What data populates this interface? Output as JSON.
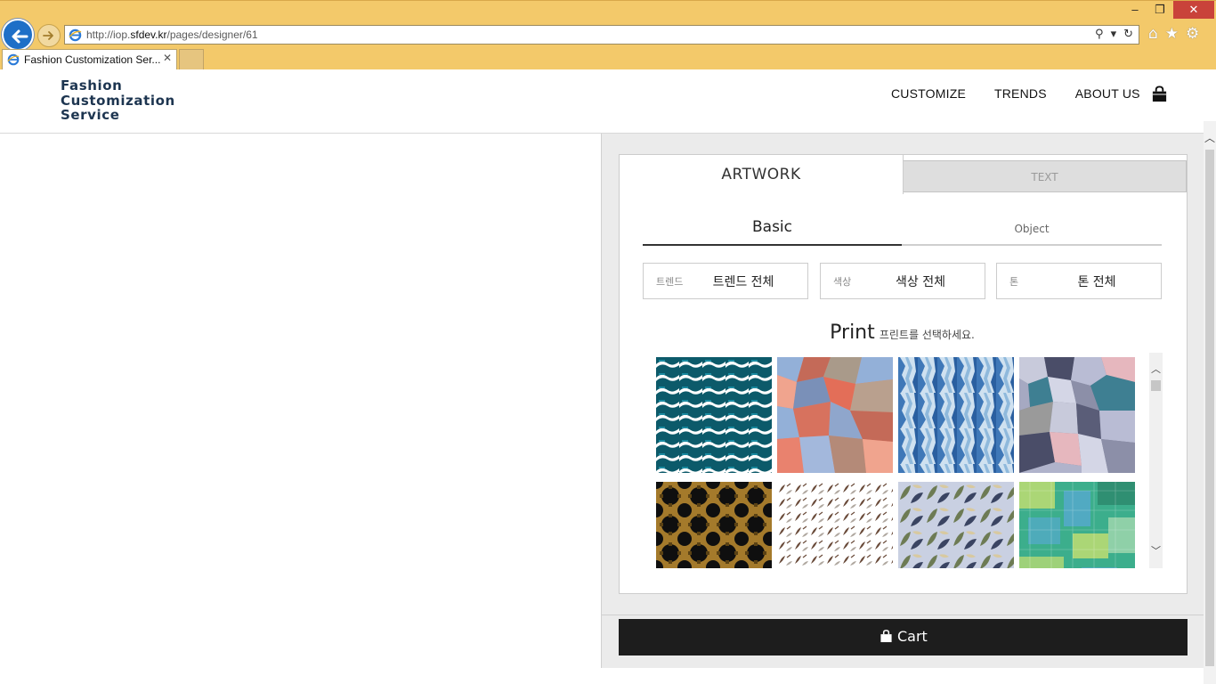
{
  "browser": {
    "url_prefix": "http://iop.",
    "url_domain": "sfdev.kr",
    "url_path": "/pages/designer/61",
    "tab_title": "Fashion Customization Ser...",
    "icons": {
      "back": "back-arrow-icon",
      "forward": "forward-arrow-icon",
      "search": "search-icon",
      "refresh": "refresh-icon",
      "home": "home-icon",
      "favorites": "star-icon",
      "settings": "gear-icon",
      "close_tab": "close-icon"
    },
    "window_buttons": {
      "minimize": "–",
      "maximize": "❐",
      "close": "✕"
    }
  },
  "site": {
    "logo_lines": [
      "Fashion",
      "Customization",
      "Service"
    ],
    "nav": [
      "CUSTOMIZE",
      "TRENDS",
      "ABOUT US"
    ],
    "cart_icon": "shopping-bag-icon"
  },
  "designer": {
    "tabs": {
      "artwork": "ARTWORK",
      "text": "TEXT"
    },
    "subtabs": {
      "basic": "Basic",
      "object": "Object"
    },
    "filters": [
      {
        "label": "트렌드",
        "value": "트렌드 전체"
      },
      {
        "label": "색상",
        "value": "색상 전체"
      },
      {
        "label": "톤",
        "value": "톤 전체"
      }
    ],
    "print_title": "Print",
    "print_hint": "프린트를 선택하세요.",
    "patterns": [
      {
        "name": "teal-fish-waves",
        "colors": [
          "#0c5a6a",
          "#ffffff",
          "#1a8aa0"
        ]
      },
      {
        "name": "coral-polygon",
        "colors": [
          "#e9826e",
          "#93b0d8",
          "#c46a58"
        ]
      },
      {
        "name": "blue-ikat-stripes",
        "colors": [
          "#3f78b8",
          "#cfe1f0",
          "#8fb9dc"
        ]
      },
      {
        "name": "grey-voronoi",
        "colors": [
          "#8c8fa8",
          "#c8cadb",
          "#3e7f92"
        ]
      },
      {
        "name": "black-gold-geometric",
        "colors": [
          "#0f0f0f",
          "#a47a2b",
          "#5b4214"
        ]
      },
      {
        "name": "brown-leaves-scatter",
        "colors": [
          "#ffffff",
          "#6a4b3a",
          "#b0a8a0"
        ]
      },
      {
        "name": "camo-leaves",
        "colors": [
          "#c9d0e2",
          "#6d7b54",
          "#3a4462"
        ]
      },
      {
        "name": "green-tweed-plaid",
        "colors": [
          "#3cae8c",
          "#c7e070",
          "#5aa8d8"
        ]
      }
    ],
    "cart_label": "Cart"
  }
}
